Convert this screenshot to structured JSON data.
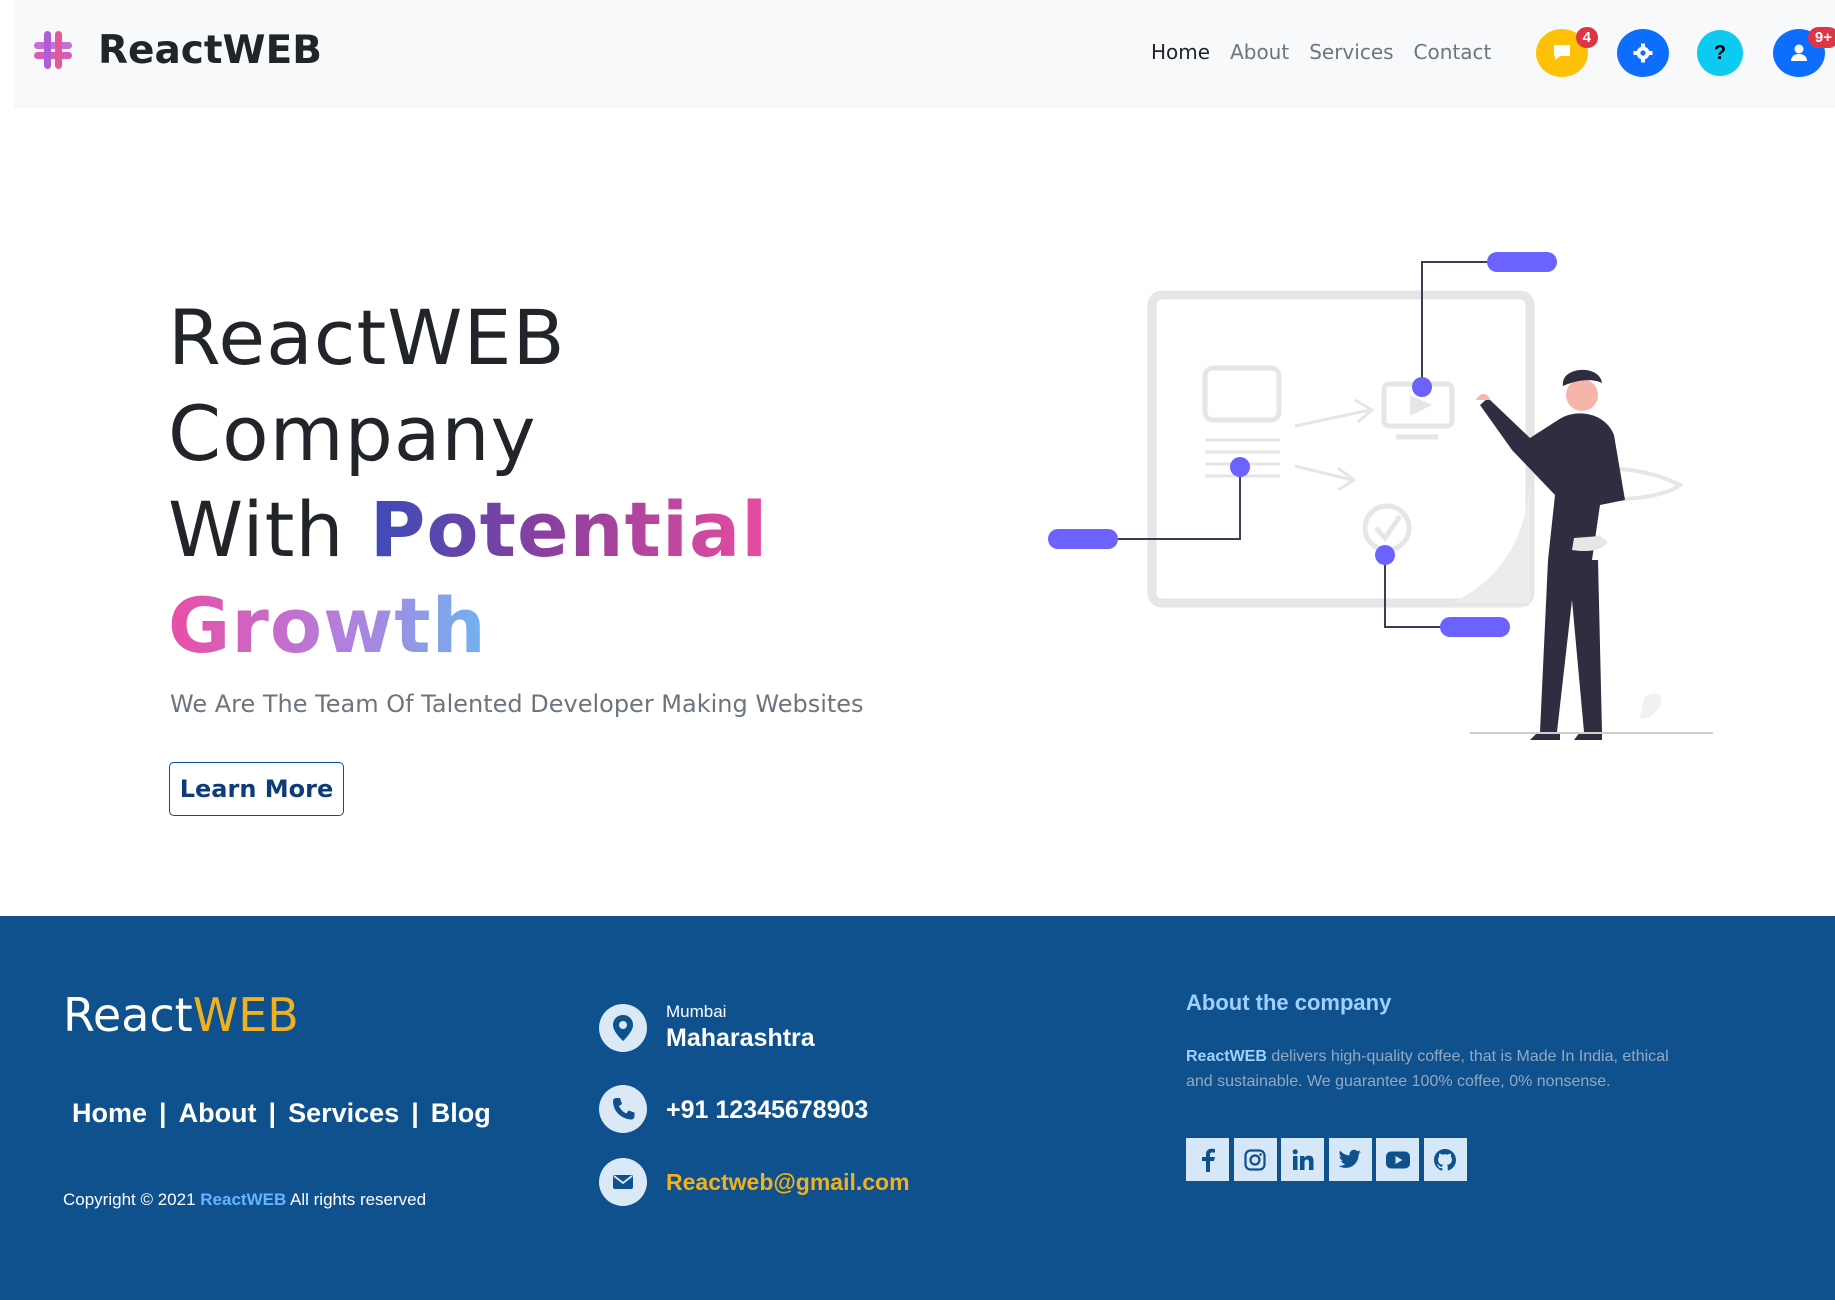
{
  "navbar": {
    "brand": "ReactWEB",
    "links": [
      "Home",
      "About",
      "Services",
      "Contact"
    ],
    "active_link": "Home",
    "buttons": [
      {
        "icon": "chat-bubble-icon",
        "color": "#ffc107",
        "badge": "4"
      },
      {
        "icon": "gear-icon",
        "color": "#0d6efd",
        "badge": ""
      },
      {
        "icon": "question-icon",
        "color": "#0dcaf0",
        "badge": ""
      },
      {
        "icon": "user-icon",
        "color": "#0d6efd",
        "badge": "9+"
      }
    ]
  },
  "hero": {
    "line1": "ReactWEB",
    "line2": "Company",
    "line3_plain": "With ",
    "line3_grad": "Potential",
    "line4": "Growth",
    "subtitle": "We Are The Team Of Talented Developer Making Websites",
    "cta": "Learn More"
  },
  "footer": {
    "logo_react": "React",
    "logo_web": "WEB",
    "nav": [
      "Home",
      "About",
      "Services",
      "Blog"
    ],
    "nav_separator": "|",
    "copyright_prefix": "Copyright © 2021 ",
    "copyright_brand": "ReactWEB",
    "copyright_suffix": " All rights reserved",
    "contact": {
      "city": "Mumbai",
      "state": "Maharashtra",
      "phone": "+91 12345678903",
      "email": "Reactweb@gmail.com"
    },
    "about": {
      "heading": "About the company",
      "brand": "ReactWEB",
      "text": " delivers high-quality coffee, that is Made In India, ethical and sustainable. We guarantee 100% coffee, 0% nonsense."
    },
    "socials": [
      "facebook-icon",
      "instagram-icon",
      "linkedin-icon",
      "twitter-icon",
      "youtube-icon",
      "github-icon"
    ]
  },
  "colors": {
    "footer_bg": "#0f518d",
    "accent_yellow": "#f0b020",
    "accent_blue": "#66b3ff",
    "illustration_purple": "#6c63ff"
  }
}
